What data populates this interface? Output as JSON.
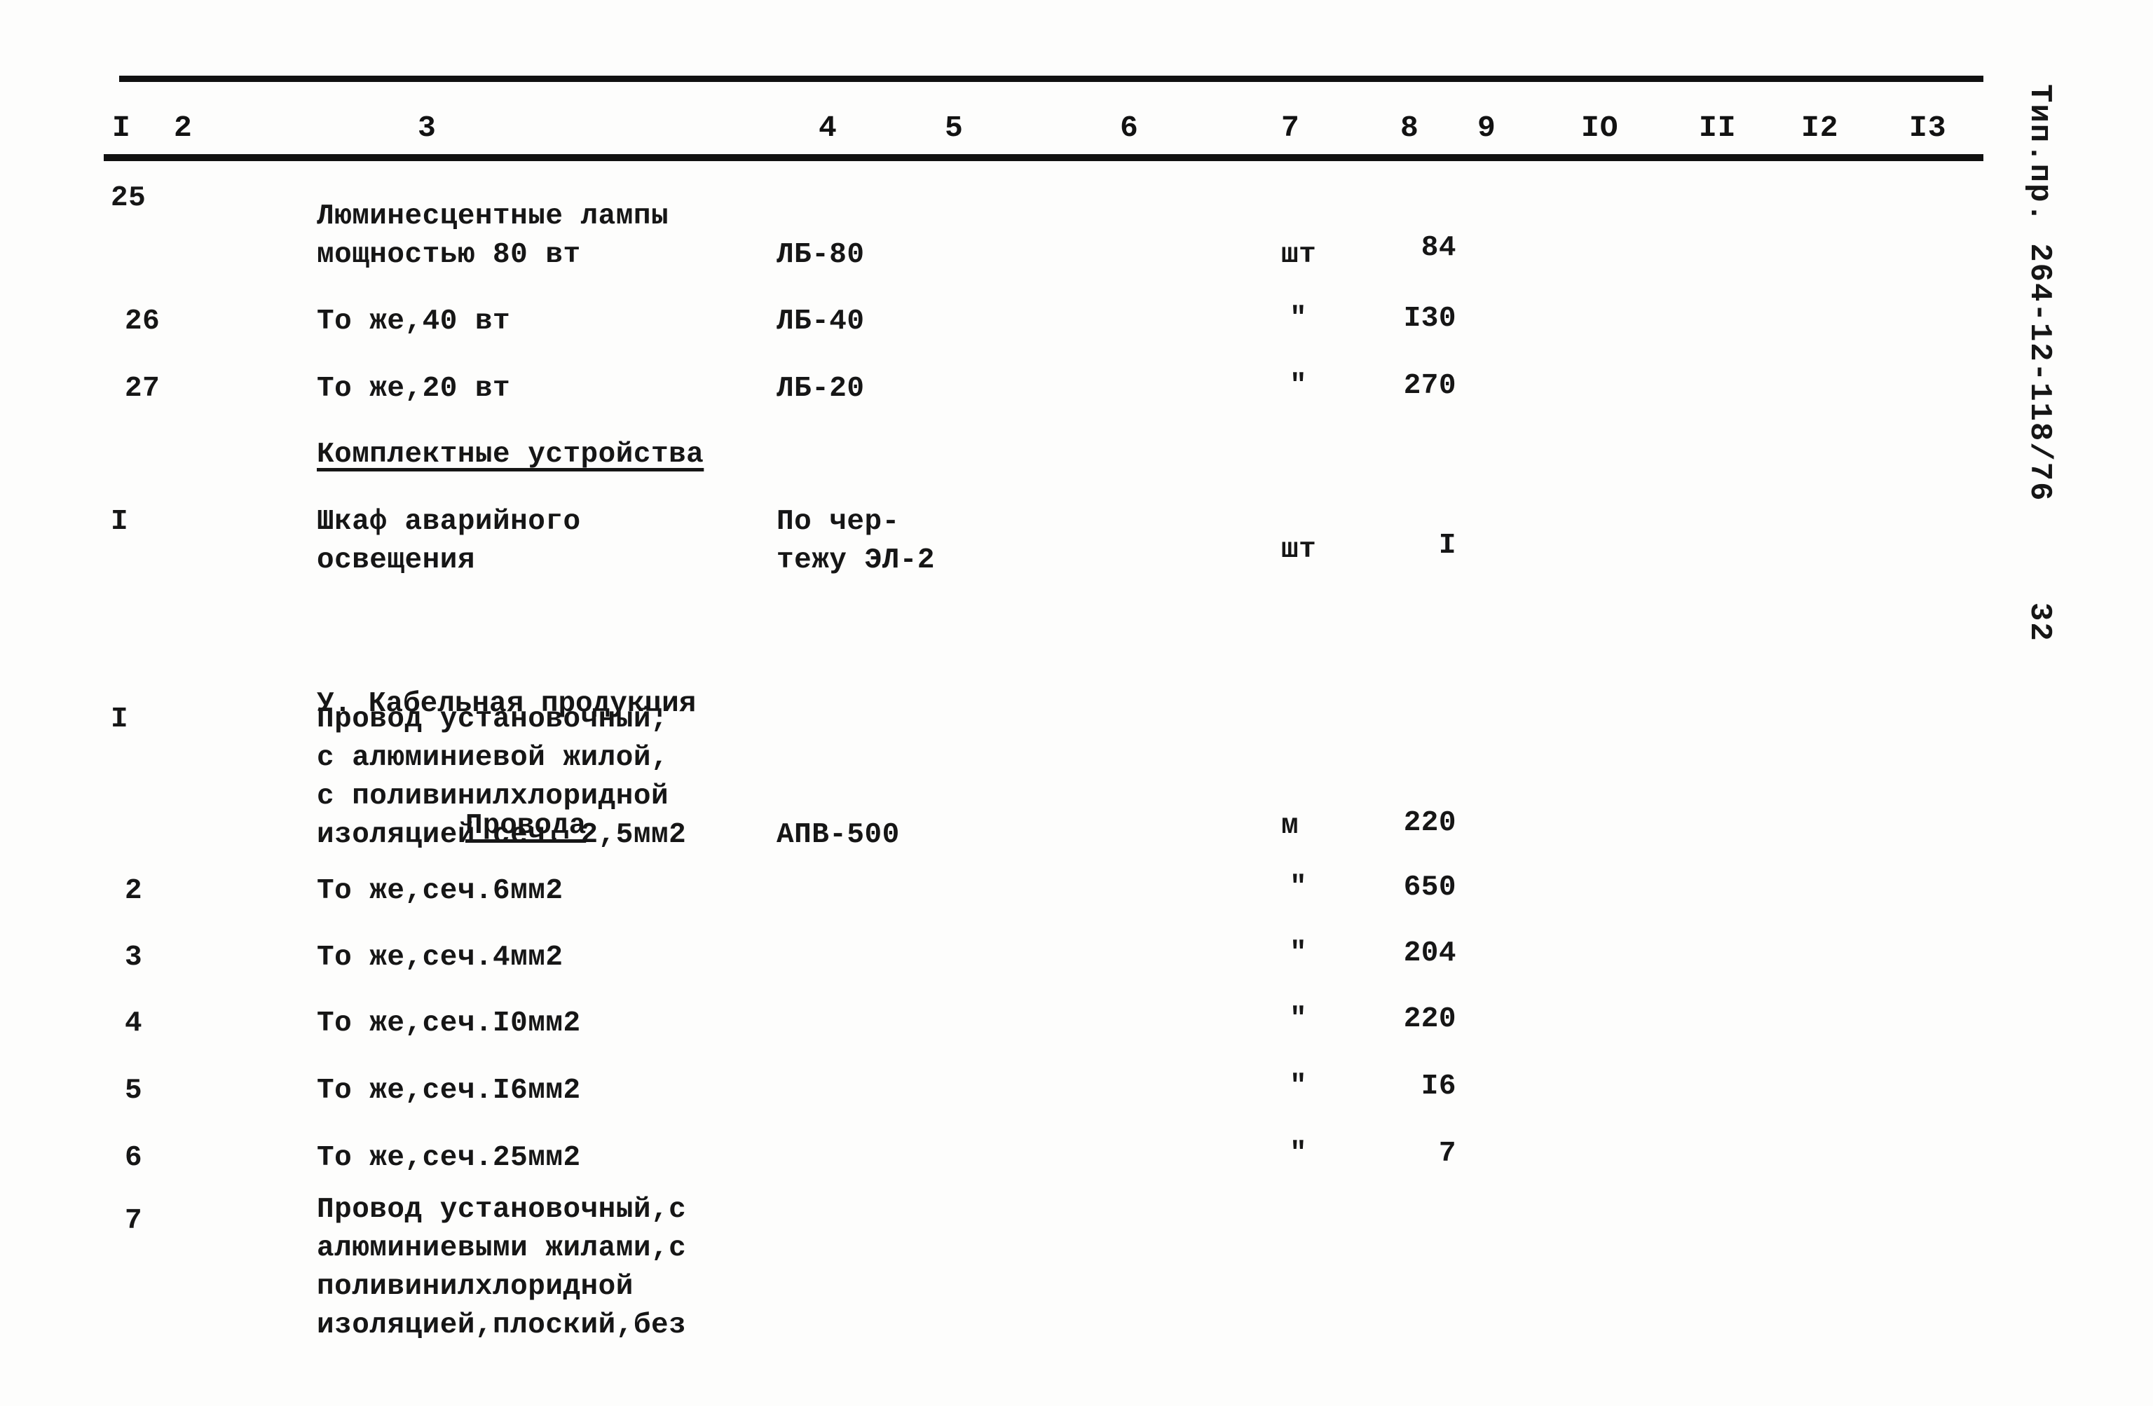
{
  "document": {
    "code_vertical": "Тип.пр. 264-12-118/76",
    "page_number": "32"
  },
  "table": {
    "column_headers": [
      "I",
      "2",
      "3",
      "4",
      "5",
      "6",
      "7",
      "8",
      "9",
      "IO",
      "II",
      "I2",
      "I3"
    ],
    "rows": [
      {
        "no": "25",
        "name": "Люминесцентные лампы\nмощностью 80 вт",
        "type": "ЛБ-80",
        "unit": "шт",
        "qty": "84"
      },
      {
        "no": "26",
        "name": "То же,40 вт",
        "type": "ЛБ-40",
        "unit": "\"",
        "qty": "I30"
      },
      {
        "no": "27",
        "name": "То же,20 вт",
        "type": "ЛБ-20",
        "unit": "\"",
        "qty": "270"
      }
    ],
    "section_complect": "Комплектные устройства",
    "rows2": [
      {
        "no": "I",
        "name": "Шкаф аварийного\nосвещения",
        "type": "По чер-\nтежу ЭЛ-2",
        "unit": "шт",
        "qty": "I"
      }
    ],
    "section_cable_line1": "У. Кабельная продукция",
    "section_cable_line2": "Провода",
    "rows3": [
      {
        "no": "I",
        "name": "Провод установочный,\nс алюминиевой жилой,\nс поливинилхлоридной\nизоляцией сеч. 2,5мм2",
        "type": "АПВ-500",
        "unit": "м",
        "qty": "220"
      },
      {
        "no": "2",
        "name": "То же,сеч.6мм2",
        "type": "",
        "unit": "\"",
        "qty": "650"
      },
      {
        "no": "3",
        "name": "То же,сеч.4мм2",
        "type": "",
        "unit": "\"",
        "qty": "204"
      },
      {
        "no": "4",
        "name": "То же,сеч.I0мм2",
        "type": "",
        "unit": "\"",
        "qty": "220"
      },
      {
        "no": "5",
        "name": "То же,сеч.I6мм2",
        "type": "",
        "unit": "\"",
        "qty": "I6"
      },
      {
        "no": "6",
        "name": "То же,сеч.25мм2",
        "type": "",
        "unit": "\"",
        "qty": "7"
      },
      {
        "no": "7",
        "name": "Провод установочный,с\nалюминиевыми жилами,с\nполивинилхлоридной\nизоляцией,плоский,без",
        "type": "",
        "unit": "",
        "qty": ""
      }
    ]
  }
}
